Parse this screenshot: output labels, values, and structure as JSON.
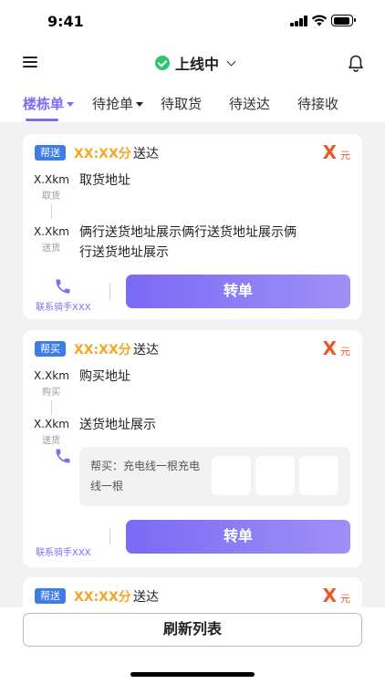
{
  "status_bar": {
    "time": "9:41"
  },
  "header": {
    "status_label": "上线中"
  },
  "tabs": [
    {
      "label": "楼栋单"
    },
    {
      "label": "待抢单"
    },
    {
      "label": "待取货"
    },
    {
      "label": "待送达"
    },
    {
      "label": "待接收"
    }
  ],
  "orders": [
    {
      "type": "帮送",
      "eta": "XX:XX分",
      "action": "送达",
      "price": "X",
      "currency": "元",
      "from_distance": "X.Xkm",
      "from_tag": "取货",
      "from_address": "取货地址",
      "to_distance": "X.Xkm",
      "to_tag": "送货",
      "to_address": "俩行送货地址展示俩行送货地址展示俩行送货地址展示",
      "contact": "联系骑手XXX",
      "button": "转单"
    },
    {
      "type": "帮买",
      "eta": "XX:XX分",
      "action": "送达",
      "price": "X",
      "currency": "元",
      "from_distance": "X.Xkm",
      "from_tag": "购买",
      "from_address": "购买地址",
      "to_distance": "X.Xkm",
      "to_tag": "送货",
      "to_address": "送货地址展示",
      "buy_note": "帮买：充电线一根充电线一根",
      "contact": "联系骑手XXX",
      "button": "转单"
    },
    {
      "type": "帮送",
      "eta": "XX:XX分",
      "action": "送达",
      "price": "X",
      "currency": "元"
    }
  ],
  "footer": {
    "refresh_label": "刷新列表"
  },
  "colors": {
    "accent": "#7c6ef2",
    "badge": "#3f7de6",
    "eta": "#f5a623",
    "price": "#e85a2a",
    "online": "#2ec46a"
  }
}
